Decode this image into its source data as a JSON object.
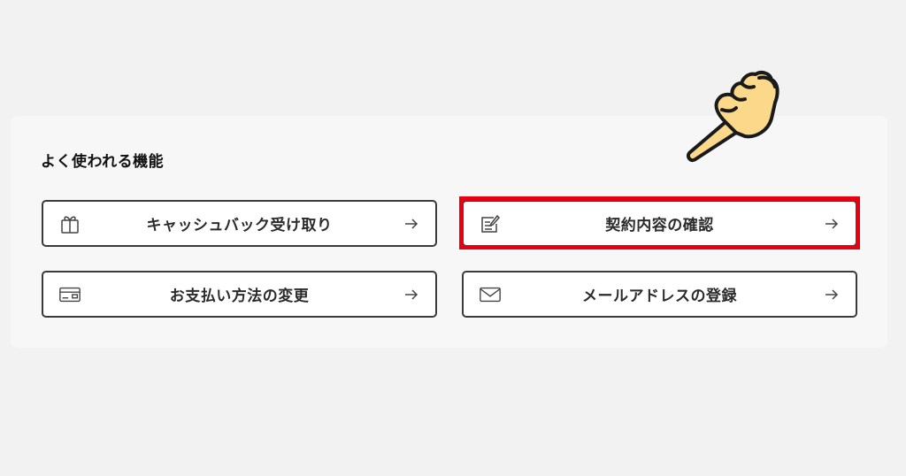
{
  "section": {
    "title": "よく使われる機能"
  },
  "buttons": [
    {
      "label": "キャッシュバック受け取り",
      "icon": "gift-icon"
    },
    {
      "label": "契約内容の確認",
      "icon": "edit-document-icon"
    },
    {
      "label": "お支払い方法の変更",
      "icon": "card-icon"
    },
    {
      "label": "メールアドレスの登録",
      "icon": "mail-icon"
    }
  ],
  "annotation": {
    "highlight_color": "#e60012",
    "pointer_icon": "pointing-hand-icon"
  },
  "colors": {
    "border": "#3a3a3a",
    "background": "#f2f2f2",
    "panel": "#f7f7f7"
  }
}
